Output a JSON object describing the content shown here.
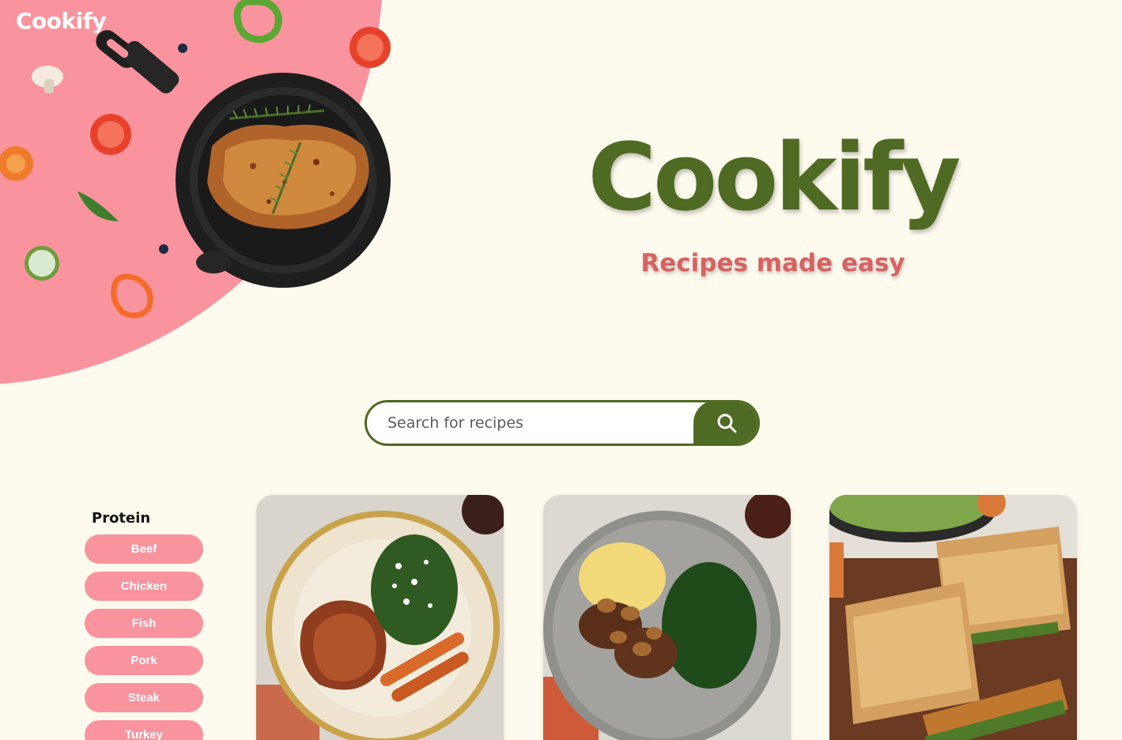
{
  "app": {
    "logo": "Cookify"
  },
  "hero": {
    "title": "Cookify",
    "tagline": "Recipes made easy"
  },
  "search": {
    "placeholder": "Search for recipes",
    "value": "",
    "button_icon": "search-icon"
  },
  "filters": {
    "heading": "Protein",
    "items": [
      {
        "label": "Beef"
      },
      {
        "label": "Chicken"
      },
      {
        "label": "Fish"
      },
      {
        "label": "Pork"
      },
      {
        "label": "Steak"
      },
      {
        "label": "Turkey"
      }
    ]
  },
  "recipes": [
    {
      "image": "spiced chicken with kale and roasted carrots"
    },
    {
      "image": "salisbury steak with mushrooms, mashed potatoes and greens"
    },
    {
      "image": "focaccia sandwiches with salad"
    }
  ],
  "colors": {
    "background": "#fefaed",
    "accent_green": "#4e6a23",
    "accent_pink": "#f9939e",
    "tagline_red": "#d76263"
  }
}
